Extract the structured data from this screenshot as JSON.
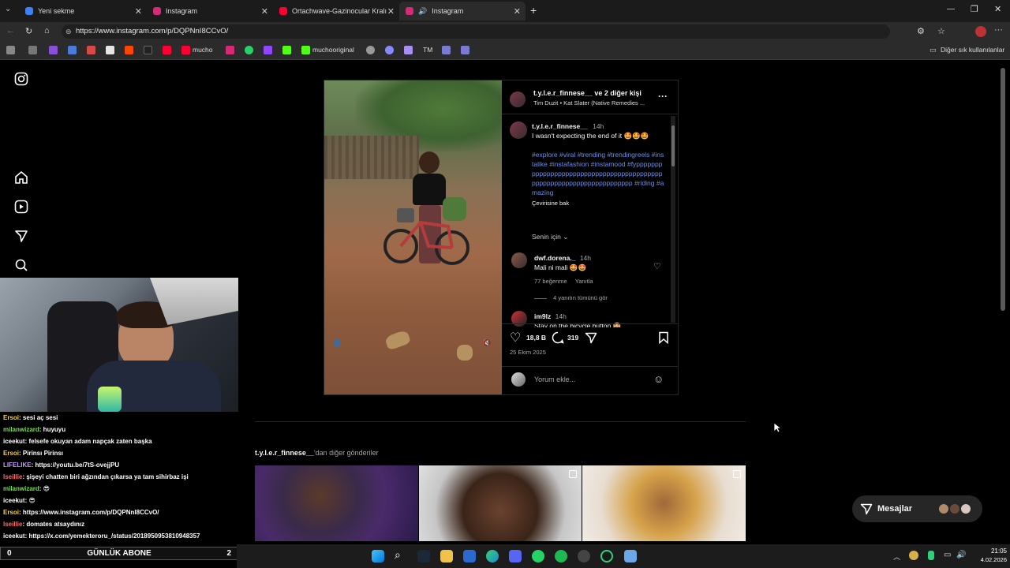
{
  "browser": {
    "tabs": [
      {
        "title": "Yeni sekme",
        "color": "#3b82f6"
      },
      {
        "title": "Instagram",
        "color": "#d62976"
      },
      {
        "title": "Ortachwave-Gazinocular Kralı(Sen",
        "color": "#ff0033"
      },
      {
        "title": "Instagram",
        "color": "#d62976"
      }
    ],
    "url": "https://www.instagram.com/p/DQPNnI8CCvO/",
    "bookmarks": {
      "mucho": "mucho",
      "muchooriginal": "muchooriginal",
      "tm": "TM",
      "other": "Diğer sık kullanılanlar"
    }
  },
  "post": {
    "header_user": "t.y.l.e.r_finnese__",
    "header_suffix": "ve 2 diğer kişi",
    "header_audio": "Tim Duzit • Kat Slater (Native Remedies ...",
    "more": "···",
    "caption_user": "t.y.l.e.r_finnese__",
    "caption_time": "14h",
    "caption_text": "I wasn't expecting the end of it 🤩🤩🤩",
    "hashtags": "#explore #viral #trending #trendingreels #instalike #instafashion #instamood #fyppppppppppppppppppppppppppppppppppppppppppppppppppppppppppppppppppppp #riding #amazing",
    "translate": "Çevirisine bak",
    "for_you": "Senin için",
    "comments": [
      {
        "user": "dwf.dorena._",
        "time": "14h",
        "text": "Mali ni mali 🤩🤩",
        "likes": "77 beğenme",
        "reply": "Yanıtla",
        "view_replies": "4 yanıtın tümünü gör"
      },
      {
        "user": "im9lz",
        "time": "14h",
        "text": "Stay on the bicycle button 🤩"
      }
    ],
    "likes": "18,8 B",
    "comment_count": "319",
    "date": "25 Ekim 2025",
    "add_comment_placeholder": "Yorum ekle..."
  },
  "more_posts": {
    "user": "t.y.l.e.r_finnese__",
    "suffix": "'dan diğer gönderiler"
  },
  "messages": {
    "label": "Mesajlar"
  },
  "chat": [
    {
      "user": "Ersoi",
      "color": "#f4d03f",
      "text": ": sesi aç sesi"
    },
    {
      "user": "milanwizard",
      "color": "#7ed957",
      "text": ": huyuyu"
    },
    {
      "user": "iceekut",
      "color": "#ffffff",
      "text": ": felsefe okuyan adam napçak zaten başka"
    },
    {
      "user": "Ersoi",
      "color": "#f4d03f",
      "text": ": Pirinsı Pirinsı"
    },
    {
      "user": "LIFELIKE",
      "color": "#c39bff",
      "text": ": https://youtu.be/7tS-ovejjPU"
    },
    {
      "user": "lseillie",
      "color": "#ff6b6b",
      "text": ": şişeyi chatten biri ağzından çıkarsa ya tam sihirbaz işi"
    },
    {
      "user": "milanwizard",
      "color": "#7ed957",
      "text": ": 😎"
    },
    {
      "user": "iceekut",
      "color": "#ffffff",
      "text": ": 😎"
    },
    {
      "user": "Ersoi",
      "color": "#f4d03f",
      "text": ": https://www.instagram.com/p/DQPNnI8CCvO/"
    },
    {
      "user": "lseillie",
      "color": "#ff6b6b",
      "text": ": domates atsaydınız"
    },
    {
      "user": "iceekut",
      "color": "#ffffff",
      "text": ": https://x.com/yemekteroru_/status/2018950953810948357"
    }
  ],
  "abone": {
    "left": "0",
    "label": "GÜNLÜK ABONE",
    "right": "2"
  },
  "clock": {
    "time": "21:05",
    "date": "4.02.2026"
  }
}
